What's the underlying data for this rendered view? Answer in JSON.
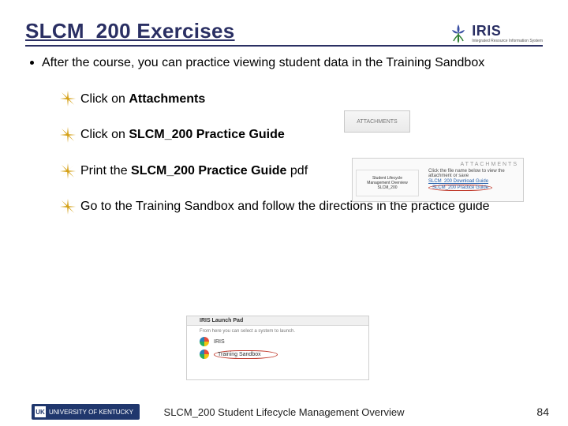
{
  "header": {
    "title": "SLCM_200 Exercises",
    "logo_text": "IRIS",
    "logo_sub": "Integrated Resource Information System"
  },
  "bullet": {
    "text": "After the course, you can practice viewing student data in the Training Sandbox"
  },
  "steps": [
    {
      "prefix": "Click on ",
      "bold": "Attachments",
      "suffix": ""
    },
    {
      "prefix": "Click on ",
      "bold": "SLCM_200 Practice Guide",
      "suffix": ""
    },
    {
      "prefix": "Print the ",
      "bold": "SLCM_200 Practice Guide",
      "suffix": " pdf"
    },
    {
      "prefix": "Go to the Training Sandbox and follow the directions in the practice guide",
      "bold": "",
      "suffix": ""
    }
  ],
  "thumb1_label": "ATTACHMENTS",
  "thumb2": {
    "header": "ATTACHMENTS",
    "hint": "Click the file name below to view the attachment or save",
    "side_line1": "Student Lifecycle",
    "side_line2": "Management Overview",
    "side_line3": "SLCM_200",
    "link1": "SLCM_200 Download Guide",
    "link2": "SLCM_200 Practice Guide"
  },
  "thumb3": {
    "bar": "IRIS Launch Pad",
    "hint": "From here you can select a system to launch.",
    "row1": "IRIS",
    "row2": "Training Sandbox"
  },
  "footer": {
    "uk_short": "UK",
    "uk_long": "UNIVERSITY OF KENTUCKY",
    "center": "SLCM_200 Student Lifecycle Management Overview",
    "page": "84"
  }
}
